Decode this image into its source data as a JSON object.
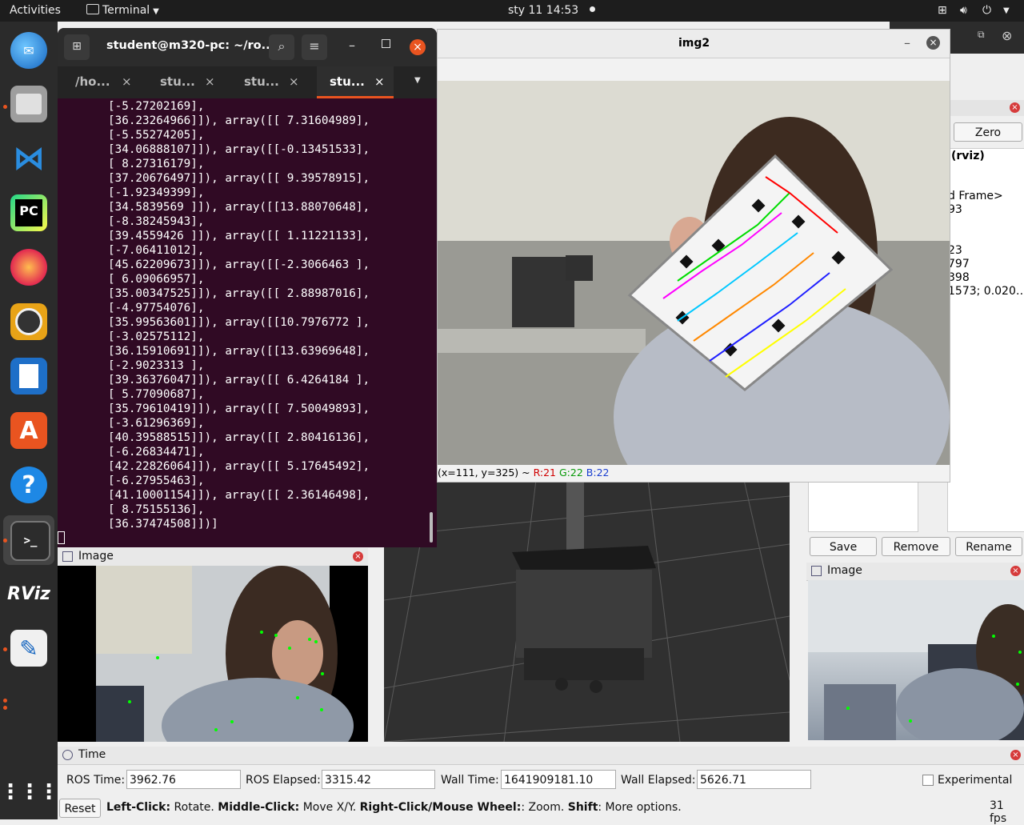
{
  "topbar": {
    "activities": "Activities",
    "app_menu": "Terminal",
    "datetime": "sty 11  14:53"
  },
  "terminal": {
    "title": "student@m320-pc: ~/ro...",
    "tabs": [
      "/ho...",
      "stu...",
      "stu...",
      "stu..."
    ],
    "lines": [
      "[-5.27202169],",
      "[36.23264966]]), array([[ 7.31604989],",
      "[-5.55274205],",
      "[34.06888107]]), array([[-0.13451533],",
      "[ 8.27316179],",
      "[37.20676497]]), array([[ 9.39578915],",
      "[-1.92349399],",
      "[34.5839569 ]]), array([[13.88070648],",
      "[-8.38245943],",
      "[39.4559426 ]]), array([[ 1.11221133],",
      "[-7.06411012],",
      "[45.62209673]]), array([[-2.3066463 ],",
      "[ 6.09066957],",
      "[35.00347525]]), array([[ 2.88987016],",
      "[-4.97754076],",
      "[35.99563601]]), array([[10.7976772 ],",
      "[-3.02575112],",
      "[36.15910691]]), array([[13.63969648],",
      "[-2.9023313 ],",
      "[39.36376047]]), array([[ 6.4264184 ],",
      "[ 5.77090687],",
      "[35.79610419]]), array([[ 7.50049893],",
      "[-3.61296369],",
      "[40.39588515]]), array([[ 2.80416136],",
      "[-6.26834471],",
      "[42.22826064]]), array([[ 5.17645492],",
      "[-6.27955463],",
      "[41.10001154]]), array([[ 2.36146498],",
      "[ 8.75155136],",
      "[36.37474508]])]"
    ]
  },
  "img2": {
    "title": "img2",
    "status_prefix": "(x=111, y=325) ~ ",
    "r": "R:21",
    "g": "G:22",
    "b": "B:22"
  },
  "rviz": {
    "zero_button": "Zero",
    "props": [
      "(rviz)",
      "d Frame>",
      "93",
      "23",
      "797",
      "398",
      "1573; 0.020…"
    ],
    "save_button": "Save",
    "remove_button": "Remove",
    "rename_button": "Rename",
    "image_panel_left": "Image",
    "image_panel_right": "Image",
    "time_panel": "Time",
    "ros_time_label": "ROS Time:",
    "ros_time_value": "3962.76",
    "ros_elapsed_label": "ROS Elapsed:",
    "ros_elapsed_value": "3315.42",
    "wall_time_label": "Wall Time:",
    "wall_time_value": "1641909181.10",
    "wall_elapsed_label": "Wall Elapsed:",
    "wall_elapsed_value": "5626.71",
    "experimental_label": "Experimental",
    "reset_button": "Reset",
    "help_left_click": "Left-Click:",
    "help_rotate": " Rotate. ",
    "help_middle_click": "Middle-Click:",
    "help_move": " Move X/Y. ",
    "help_right_click": "Right-Click/Mouse Wheel:",
    "help_zoom": ": Zoom. ",
    "help_shift": "Shift",
    "help_more": ": More options.",
    "fps": "31 fps"
  },
  "colors": {
    "terminal_bg": "#300a24",
    "accent": "#e95420",
    "r_color": "#d00000",
    "g_color": "#0a9a0a",
    "b_color": "#1a3fd0"
  },
  "dock": [
    "thunderbird-icon",
    "files-icon",
    "vscode-icon",
    "pycharm-icon",
    "firefox-icon",
    "rhythmbox-icon",
    "writer-icon",
    "software-icon",
    "help-icon",
    "terminal-icon",
    "rviz-icon",
    "text-editor-icon",
    "app-grid-icon"
  ]
}
